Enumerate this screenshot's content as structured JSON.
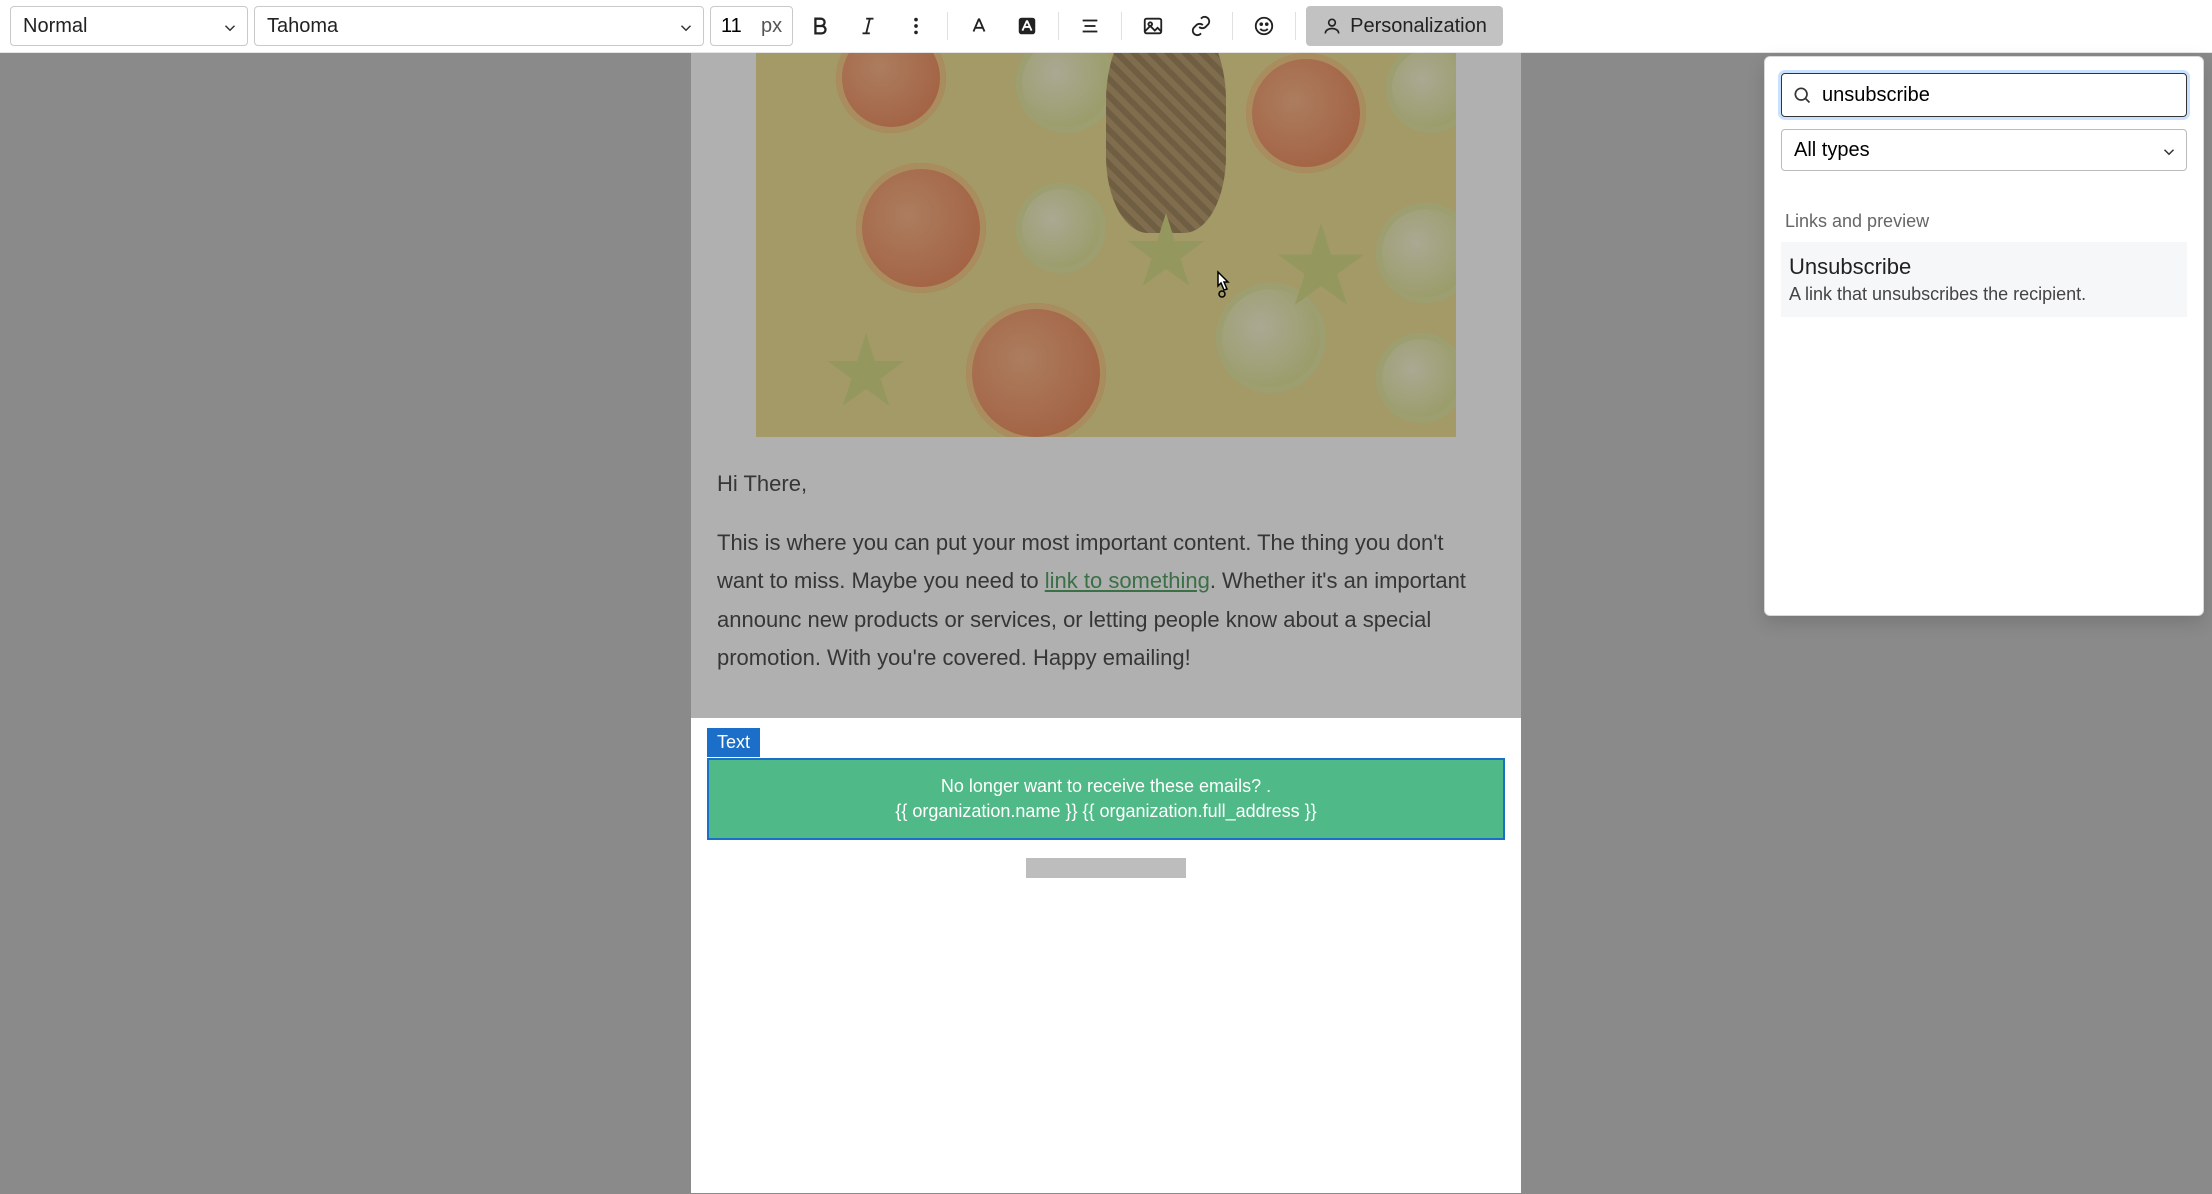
{
  "toolbar": {
    "paragraph_style": "Normal",
    "font_family": "Tahoma",
    "font_size": "11",
    "font_unit": "px",
    "personalization_label": "Personalization"
  },
  "email": {
    "greeting": "Hi There,",
    "body_part1": "This is where you can put your most important content. The thing you don't want to miss. Maybe you need to ",
    "link_text": "link to something",
    "body_part2": ". Whether it's an important announc new products or services, or letting people know about a special promotion. With you're covered. Happy emailing!",
    "text_block_tag": "Text",
    "footer_line1": "No longer want to receive these emails? .",
    "footer_line2": "{{ organization.name }} {{ organization.full_address }}"
  },
  "dropdown": {
    "search_value": "unsubscribe",
    "types_label": "All types",
    "section_label": "Links and preview",
    "result_title": "Unsubscribe",
    "result_desc": "A link that unsubscribes the recipient."
  }
}
